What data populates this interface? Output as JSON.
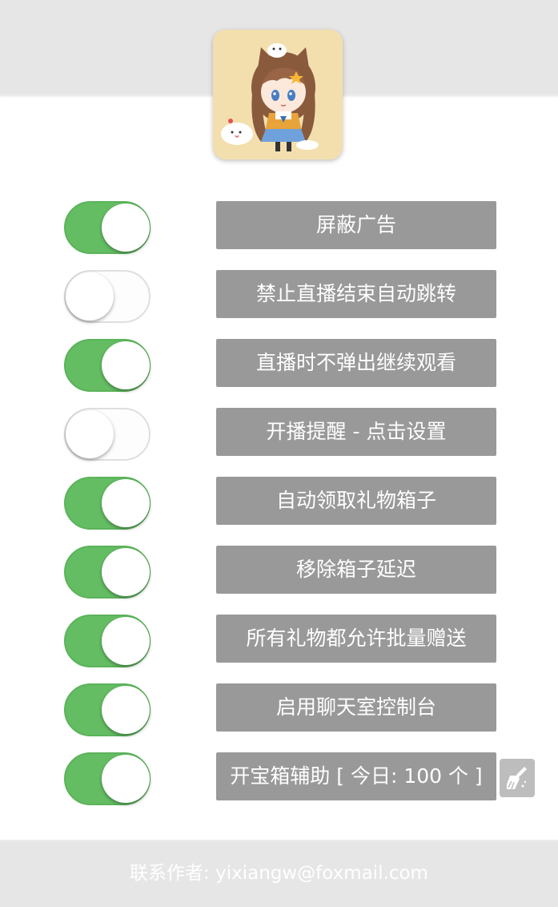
{
  "header": {
    "avatar_icon": "anime-avatar-icon"
  },
  "settings": [
    {
      "label": "屏蔽广告",
      "enabled": true
    },
    {
      "label": "禁止直播结束自动跳转",
      "enabled": false
    },
    {
      "label": "直播时不弹出继续观看",
      "enabled": true
    },
    {
      "label": "开播提醒 - 点击设置",
      "enabled": false
    },
    {
      "label": "自动领取礼物箱子",
      "enabled": true
    },
    {
      "label": "移除箱子延迟",
      "enabled": true
    },
    {
      "label": "所有礼物都允许批量赠送",
      "enabled": true
    },
    {
      "label": "启用聊天室控制台",
      "enabled": true
    },
    {
      "label": "开宝箱辅助 [ 今日: 100 个 ]",
      "enabled": true
    }
  ],
  "clean_button": {
    "icon": "broom-icon"
  },
  "footer": {
    "contact": "联系作者: yixiangw@foxmail.com"
  },
  "colors": {
    "toggle_on": "#64bd63",
    "toggle_off": "#fdfdfd",
    "label_bg": "#999999",
    "header_bg": "#e6e6e6"
  }
}
